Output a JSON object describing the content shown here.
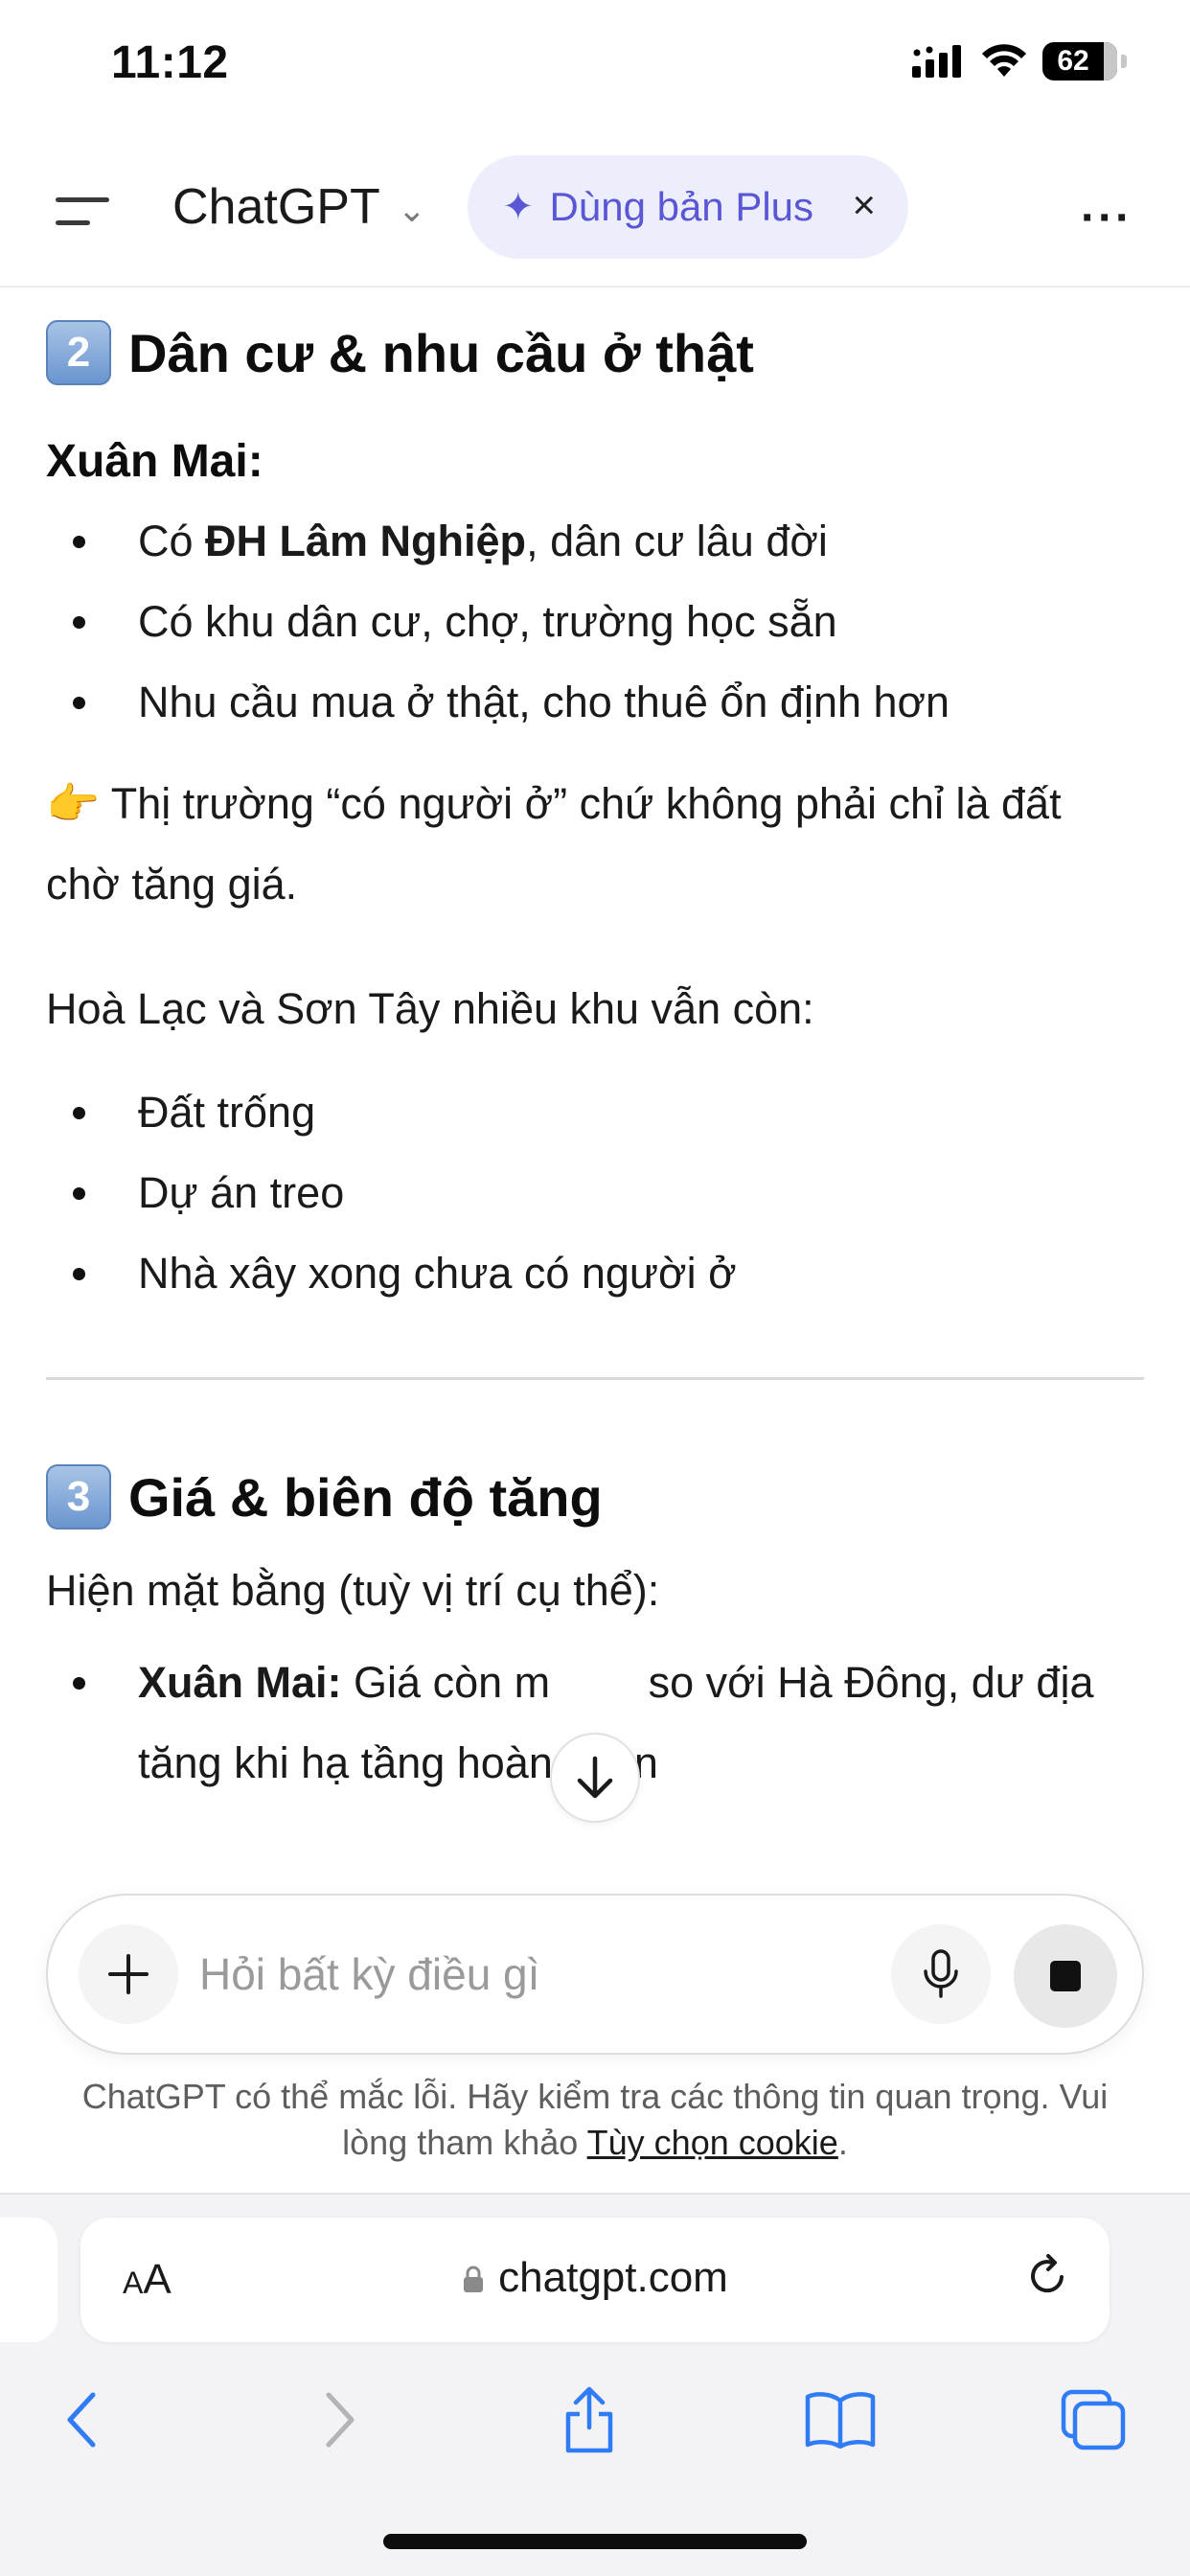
{
  "status_bar": {
    "time": "11:12",
    "battery": "62"
  },
  "header": {
    "app_title": "ChatGPT",
    "upgrade_pill": "Dùng bản Plus",
    "upgrade_close": "×",
    "more": "···"
  },
  "content": {
    "section2": {
      "number": "2",
      "title": "Dân cư & nhu cầu ở thật",
      "subheading": "Xuân Mai:",
      "bullets": [
        {
          "prefix": "Có ",
          "bold": "ĐH Lâm Nghiệp",
          "suffix": ", dân cư lâu đời"
        },
        {
          "text": "Có khu dân cư, chợ, trường học sẵn"
        },
        {
          "text": "Nhu cầu mua ở thật, cho thuê ổn định hơn"
        }
      ],
      "pointer_emoji": "👉",
      "pointer_text": "Thị trường “có người ở” chứ không phải chỉ là đất chờ tăng giá.",
      "compare_text": "Hoà Lạc và Sơn Tây nhiều khu vẫn còn:",
      "compare_bullets": [
        "Đất trống",
        "Dự án treo",
        "Nhà xây xong chưa có người ở"
      ]
    },
    "section3": {
      "number": "3",
      "title": "Giá & biên độ tăng",
      "intro": "Hiện mặt bằng (tuỳ vị trí cụ thể):",
      "bullet_bold": "Xuân Mai:",
      "bullet_line1_a": " Giá còn m",
      "bullet_line1_b": " so với Hà Đông, dư địa",
      "bullet_line2": "tăng khi hạ tầng hoàn thiện"
    }
  },
  "composer": {
    "placeholder": "Hỏi bất kỳ điều gì"
  },
  "disclaimer": {
    "text_line1": "ChatGPT có thể mắc lỗi. Hãy kiểm tra các thông tin quan trọng. Vui",
    "text_line2_prefix": "lòng tham khảo ",
    "cookie_link": "Tùy chọn cookie",
    "text_line2_suffix": "."
  },
  "safari": {
    "aa_small": "A",
    "aa_big": "A",
    "url": "chatgpt.com"
  }
}
